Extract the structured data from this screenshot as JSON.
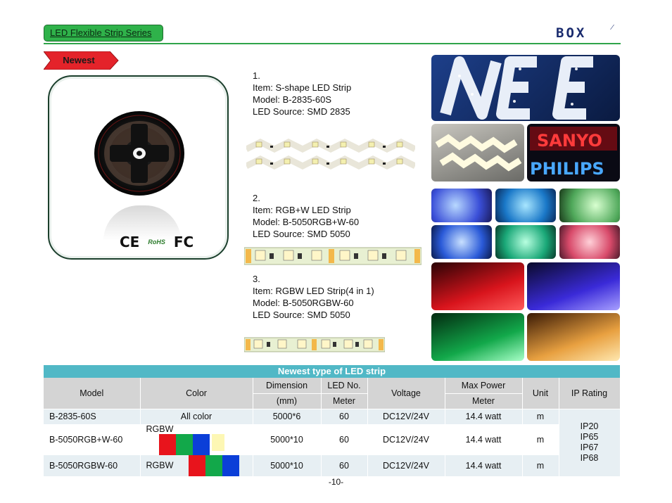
{
  "header": {
    "series_label": "LED Flexible Strip Series",
    "brand_logo": "BOX",
    "accent_color": "#2fb24a"
  },
  "badge": {
    "newest_label": "Newest",
    "color": "#e4232a"
  },
  "certifications": {
    "ce": "CE",
    "rohs": "RoHS",
    "fc": "FC"
  },
  "items": [
    {
      "index": "1.",
      "item": "Item: S-shape LED Strip",
      "model": "Model: B-2835-60S",
      "source": "LED Source: SMD 2835"
    },
    {
      "index": "2.",
      "item": "Item: RGB+W LED Strip",
      "model": "Model: B-5050RGB+W-60",
      "source": "LED Source: SMD 5050"
    },
    {
      "index": "3.",
      "item": "Item: RGBW LED Strip(4 in 1)",
      "model": "Model: B-5050RGBW-60",
      "source": "LED Source: SMD 5050"
    }
  ],
  "table": {
    "title": "Newest type of LED strip",
    "headers": {
      "model": "Model",
      "color": "Color",
      "dimension": "Dimension",
      "dimension_unit": "(mm)",
      "led_no": "LED No.",
      "led_no_unit": "Meter",
      "voltage": "Voltage",
      "max_power": "Max Power",
      "max_power_unit": "Meter",
      "unit": "Unit",
      "ip_rating": "IP Rating"
    },
    "rows": [
      {
        "model": "B-2835-60S",
        "color": "All color",
        "dimension": "5000*6",
        "led_no": "60",
        "voltage": "DC12V/24V",
        "power": "14.4 watt",
        "unit": "m"
      },
      {
        "model": "B-5050RGB+W-60",
        "color": "RGBW",
        "dimension": "5000*10",
        "led_no": "60",
        "voltage": "DC12V/24V",
        "power": "14.4 watt",
        "unit": "m"
      },
      {
        "model": "B-5050RGBW-60",
        "color": "RGBW",
        "dimension": "5000*10",
        "led_no": "60",
        "voltage": "DC12V/24V",
        "power": "14.4 watt",
        "unit": "m"
      }
    ],
    "ip_ratings": [
      "IP20",
      "IP65",
      "IP67",
      "IP68"
    ],
    "swatch_colors": {
      "red": "#e8141c",
      "green": "#12a84a",
      "blue": "#0b3fd8",
      "warm_white": "#fdf7b4"
    }
  },
  "footer": {
    "page_number": "-10-"
  }
}
